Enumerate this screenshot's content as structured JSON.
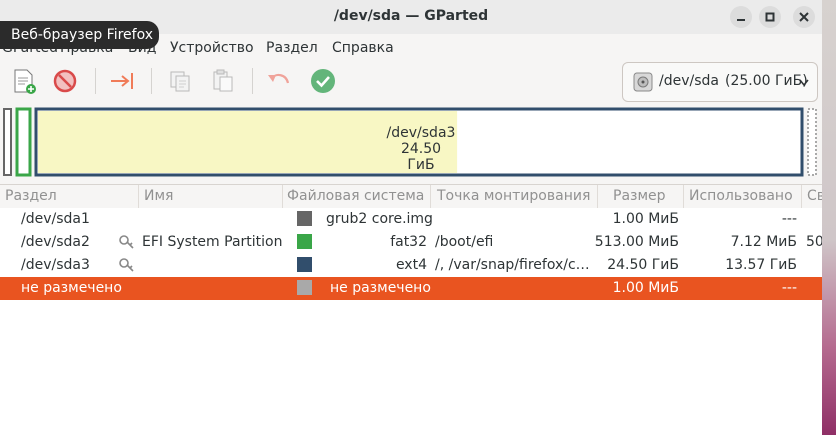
{
  "window": {
    "title": "/dev/sda — GParted",
    "tooltip": "Веб-браузер Firefox"
  },
  "menu": [
    "Вид",
    "Устройство",
    "Раздел",
    "Справка"
  ],
  "menu_partial": [
    "GParted",
    "Правка"
  ],
  "toolbar": {
    "icons": [
      "new-partition-icon",
      "delete-icon",
      "resize-move-icon",
      "copy-icon",
      "paste-icon",
      "undo-icon",
      "apply-icon"
    ]
  },
  "device": {
    "name": "/dev/sda",
    "size": "(25.00 ГиБ)"
  },
  "partition_map": {
    "name": "/dev/sda3",
    "size": "24.50 ГиБ",
    "used_fraction": 0.55
  },
  "columns": [
    "Раздел",
    "Имя",
    "Файловая система",
    "Точка монтирования",
    "Размер",
    "Использовано",
    "Св"
  ],
  "rows": [
    {
      "partition": "/dev/sda1",
      "name": "",
      "fs": "grub2 core.img",
      "fs_color": "#666666",
      "mount": "",
      "size": "1.00 МиБ",
      "used": "---",
      "free": "",
      "key": false,
      "selected": false
    },
    {
      "partition": "/dev/sda2",
      "name": "EFI System Partition",
      "fs": "fat32",
      "fs_color": "#3aa648",
      "mount": "/boot/efi",
      "size": "513.00 МиБ",
      "used": "7.12 МиБ",
      "free": "50",
      "key": true,
      "selected": false
    },
    {
      "partition": "/dev/sda3",
      "name": "",
      "fs": "ext4",
      "fs_color": "#314e6c",
      "mount": "/, /var/snap/firefox/c…",
      "size": "24.50 ГиБ",
      "used": "13.57 ГиБ",
      "free": "",
      "key": true,
      "selected": false
    },
    {
      "partition": "не размечено",
      "name": "",
      "fs": "не размечено",
      "fs_color": "#a9a9a9",
      "mount": "",
      "size": "1.00 МиБ",
      "used": "---",
      "free": "",
      "key": false,
      "selected": true
    }
  ],
  "colors": {
    "selection": "#e95420",
    "used": "#f8f7c4",
    "ext4_border": "#314e6c",
    "fat32": "#3aa648",
    "grub": "#666666"
  }
}
